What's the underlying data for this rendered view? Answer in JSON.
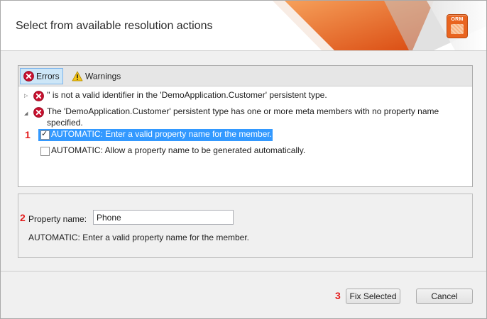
{
  "window": {
    "title": "Select from available resolution actions",
    "badge_text": "ORM"
  },
  "tabs": [
    {
      "label": "Errors",
      "icon": "error-icon",
      "active": true
    },
    {
      "label": "Warnings",
      "icon": "warning-icon",
      "active": false
    }
  ],
  "issues": [
    {
      "text": "'' is not a valid identifier in the 'DemoApplication.Customer' persistent type.",
      "expanded": false
    },
    {
      "text_line1": "The 'DemoApplication.Customer' persistent type has one or more meta members with no property name",
      "text_line2": "specified.",
      "expanded": true,
      "actions": [
        {
          "label": "AUTOMATIC: Enter a valid property name for the member.",
          "checked": true,
          "selected": true
        },
        {
          "label": "AUTOMATIC: Allow a property name to be generated automatically.",
          "checked": false,
          "selected": false
        }
      ]
    }
  ],
  "properties": {
    "label": "Property name:",
    "value": "Phone",
    "description": "AUTOMATIC: Enter a valid property name for the member."
  },
  "footer": {
    "fix_label": "Fix Selected",
    "cancel_label": "Cancel"
  },
  "markers": [
    "1",
    "2",
    "3"
  ],
  "colors": {
    "accent_orange": "#e9641f",
    "selection_blue": "#3399ff",
    "active_tab": "#cde6f7",
    "marker_red": "#e31b1b",
    "error_red": "#c8102e",
    "warning_yellow": "#f5c518"
  }
}
